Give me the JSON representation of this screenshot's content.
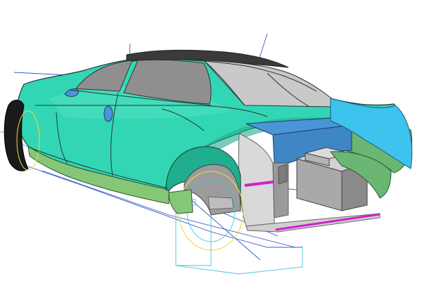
{
  "viewport": {
    "background": "#ffffff"
  },
  "model": {
    "body_color": "#33d6b4",
    "body_highlight": "#5fe8c8",
    "body_shadow": "#1fae8e",
    "sill_color": "#86c777",
    "glass_color": "#8f8f8f",
    "glass_light": "#c9c9c9",
    "roof_dark": "#3a3a3a",
    "interior_light": "#d9d9d9",
    "panel_blue": "#4a94d8",
    "panel_cyan": "#3ec2ee",
    "flare_green": "#6ab673",
    "magenta": "#d21fd0",
    "wire_blue": "#3b58c9",
    "wire_cyan": "#46c6d6",
    "wire_yellow": "#e6df3c",
    "tire": "#1a1a1a"
  }
}
